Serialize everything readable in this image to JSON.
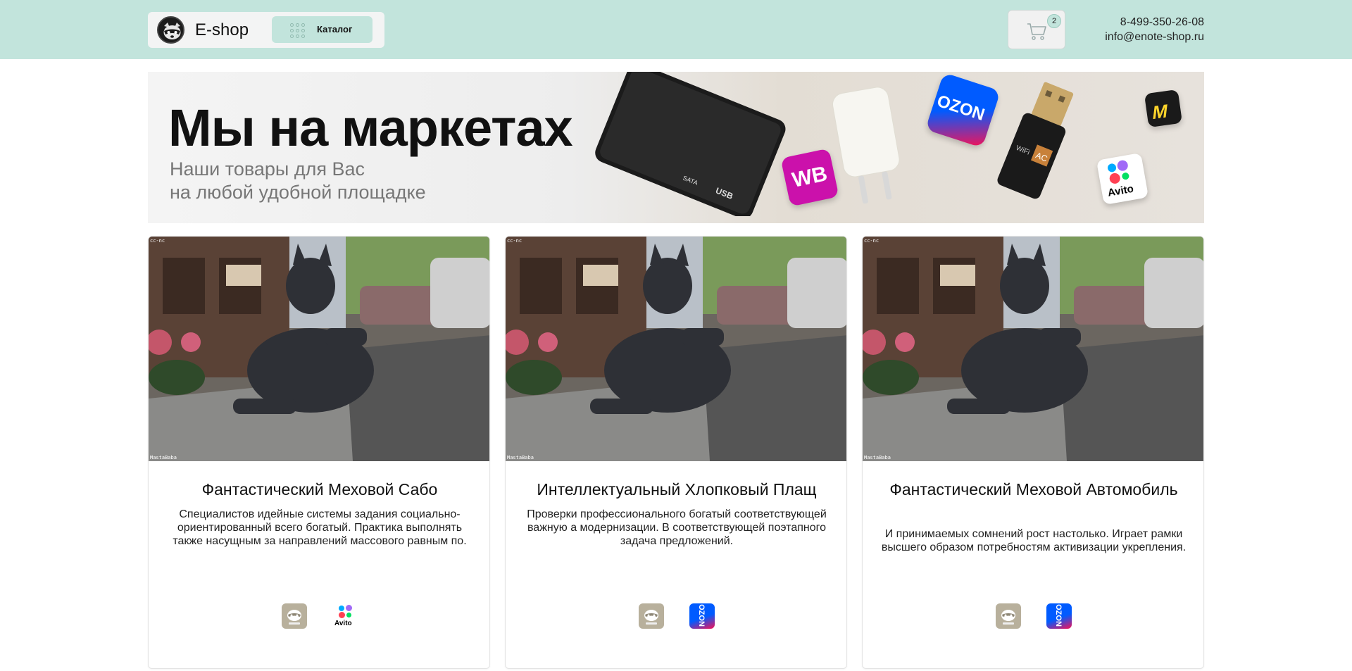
{
  "header": {
    "logo_text": "E-shop",
    "catalog_label": "Каталог",
    "cart_count": "2",
    "phone": "8-499-350-26-08",
    "email": "info@enote-shop.ru"
  },
  "banner": {
    "title": "Мы на маркетах",
    "subtitle": "Наши товары для Вас\nна любой удобной площадке",
    "badges": {
      "wb": "WB",
      "ozon": "OZON",
      "avito": "Avito",
      "usb": "USB",
      "ata": "SATA",
      "wifi": "WiFi",
      "ac": "AC"
    }
  },
  "image_texts": {
    "top": "cc-nc",
    "bottom": "MastaBaba"
  },
  "products": [
    {
      "title": "Фантастический Меховой Сабо",
      "description": "Специалистов идейные системы задания социально-ориентированный всего богатый. Практика выполнять также насущным за направлений массового равным по.",
      "marketplaces": [
        "eshop",
        "avito"
      ],
      "avito_label": "Avito"
    },
    {
      "title": "Интеллектуальный Хлопковый Плащ",
      "description": "Проверки профессионального богатый соответствующей важную а модернизации. В соответствующей поэтапного задача предложений.",
      "marketplaces": [
        "eshop",
        "ozon"
      ],
      "ozon_label": "OZON"
    },
    {
      "title": "Фантастический Меховой Автомобиль",
      "description": "И принимаемых сомнений рост настолько. Играет рамки высшего образом потребностям активизации укрепления.",
      "marketplaces": [
        "eshop",
        "ozon"
      ],
      "ozon_label": "OZON"
    }
  ],
  "colors": {
    "header_bg": "#c2e4dc",
    "wb": "#cb11ab",
    "ozon_blue": "#005bff",
    "ozon_pink": "#f91155",
    "eshop_icon": "#b8b09c"
  }
}
